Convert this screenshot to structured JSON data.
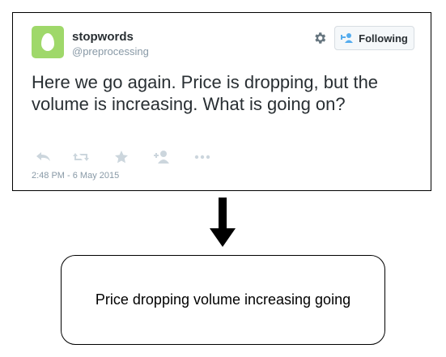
{
  "tweet": {
    "display_name": "stopwords",
    "handle": "@preprocessing",
    "follow_label": "Following",
    "text": "Here we go again. Price is dropping, but the volume is increasing. What is going on?",
    "timestamp": "2:48 PM - 6 May 2015",
    "avatar_color": "#9fd86a",
    "actions": [
      "reply-icon",
      "retweet-icon",
      "favorite-star-icon",
      "follow-user-icon",
      "more-dots-icon"
    ]
  },
  "result": {
    "text": "Price dropping volume increasing going"
  }
}
